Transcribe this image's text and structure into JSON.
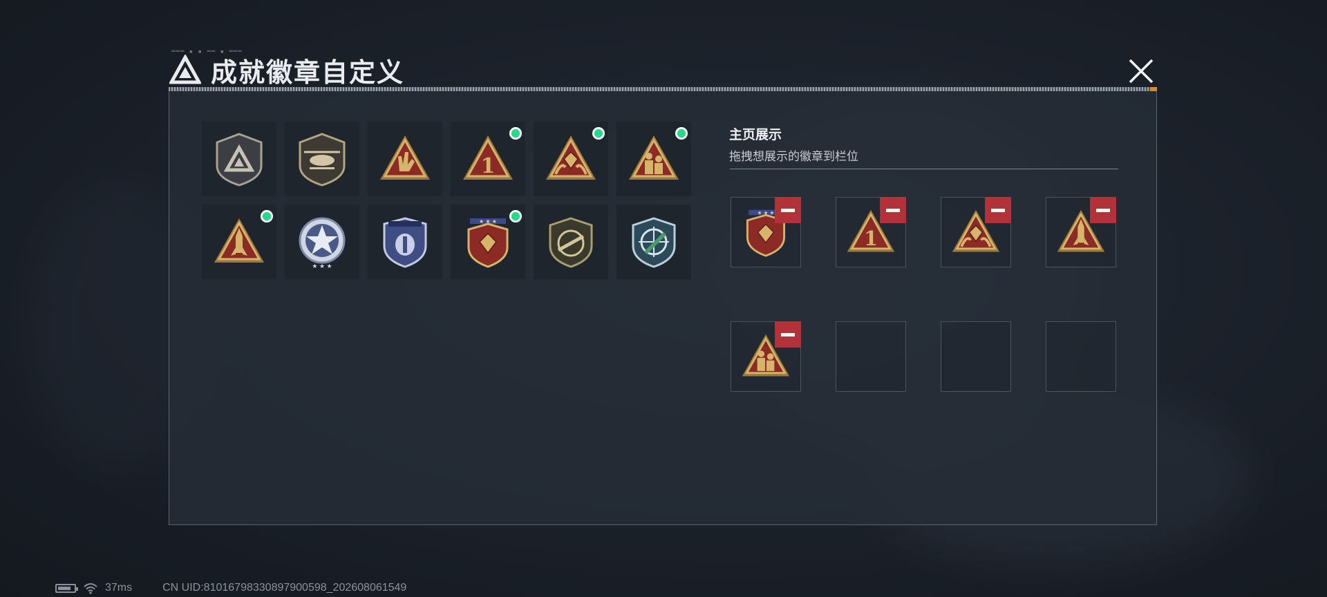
{
  "header": {
    "title": "成就徽章自定义",
    "tiny_text": "═══ ▪ ▪ ══ ▪ ═══"
  },
  "showcase": {
    "title": "主页展示",
    "subtitle": "拖拽想展示的徽章到栏位"
  },
  "badges": [
    {
      "icon": "silver-triangle-shield-badge-icon",
      "new": false
    },
    {
      "icon": "helicopter-badge-icon",
      "new": false
    },
    {
      "icon": "hand-gesture-triangle-badge-icon",
      "new": false
    },
    {
      "icon": "number-one-triangle-badge-icon",
      "new": true
    },
    {
      "icon": "gem-hands-triangle-badge-icon",
      "new": true
    },
    {
      "icon": "soldiers-triangle-badge-icon",
      "new": true
    },
    {
      "icon": "rocket-triangle-badge-icon",
      "new": true
    },
    {
      "icon": "star-emblem-badge-icon",
      "new": false
    },
    {
      "icon": "blue-shield-badge-icon",
      "new": false
    },
    {
      "icon": "red-gem-shield-badge-icon",
      "new": true
    },
    {
      "icon": "rifle-shield-badge-icon",
      "new": false
    },
    {
      "icon": "crosshair-shield-badge-icon",
      "new": false
    }
  ],
  "slots": [
    {
      "icon": "red-gem-shield-badge-icon",
      "filled": true
    },
    {
      "icon": "number-one-triangle-badge-icon",
      "filled": true
    },
    {
      "icon": "gem-hands-triangle-badge-icon",
      "filled": true
    },
    {
      "icon": "rocket-triangle-badge-icon",
      "filled": true
    },
    {
      "icon": "soldiers-triangle-badge-icon",
      "filled": true
    },
    {
      "icon": "",
      "filled": false
    },
    {
      "icon": "",
      "filled": false
    },
    {
      "icon": "",
      "filled": false
    }
  ],
  "status": {
    "ping": "37ms",
    "uid": "CN UID:810167983308979005​98_202608061549"
  },
  "colors": {
    "new_dot": "#1fdc86",
    "remove": "#b3323a",
    "gold": "#d6b46a",
    "crimson": "#8c2a26"
  }
}
